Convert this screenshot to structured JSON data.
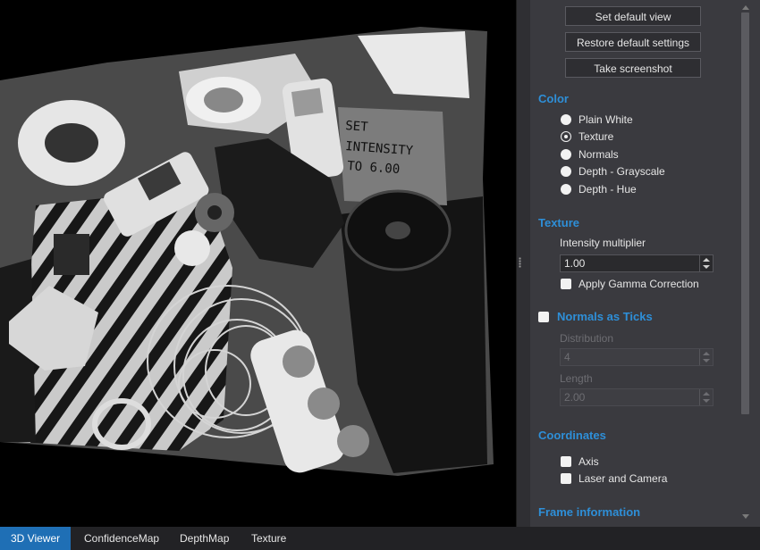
{
  "panel": {
    "buttons": {
      "set_default_view": "Set default view",
      "restore_defaults": "Restore default settings",
      "take_screenshot": "Take screenshot"
    },
    "color": {
      "title": "Color",
      "options": [
        "Plain White",
        "Texture",
        "Normals",
        "Depth - Grayscale",
        "Depth - Hue"
      ],
      "selected": "Texture"
    },
    "texture": {
      "title": "Texture",
      "intensity_label": "Intensity multiplier",
      "intensity_value": "1.00",
      "gamma_label": "Apply Gamma Correction",
      "gamma_checked": false
    },
    "normals": {
      "title": "Normals as Ticks",
      "checked": false,
      "distribution_label": "Distribution",
      "distribution_value": "4",
      "length_label": "Length",
      "length_value": "2.00"
    },
    "coordinates": {
      "title": "Coordinates",
      "axis_label": "Axis",
      "axis_checked": false,
      "laser_label": "Laser and Camera",
      "laser_checked": false
    },
    "frame_info": {
      "title": "Frame information"
    }
  },
  "viewport": {
    "box_text": [
      "SET",
      "INTENSITY",
      "TO 6.00"
    ]
  },
  "tabs": [
    {
      "label": "3D Viewer",
      "active": true
    },
    {
      "label": "ConfidenceMap",
      "active": false
    },
    {
      "label": "DepthMap",
      "active": false
    },
    {
      "label": "Texture",
      "active": false
    }
  ]
}
